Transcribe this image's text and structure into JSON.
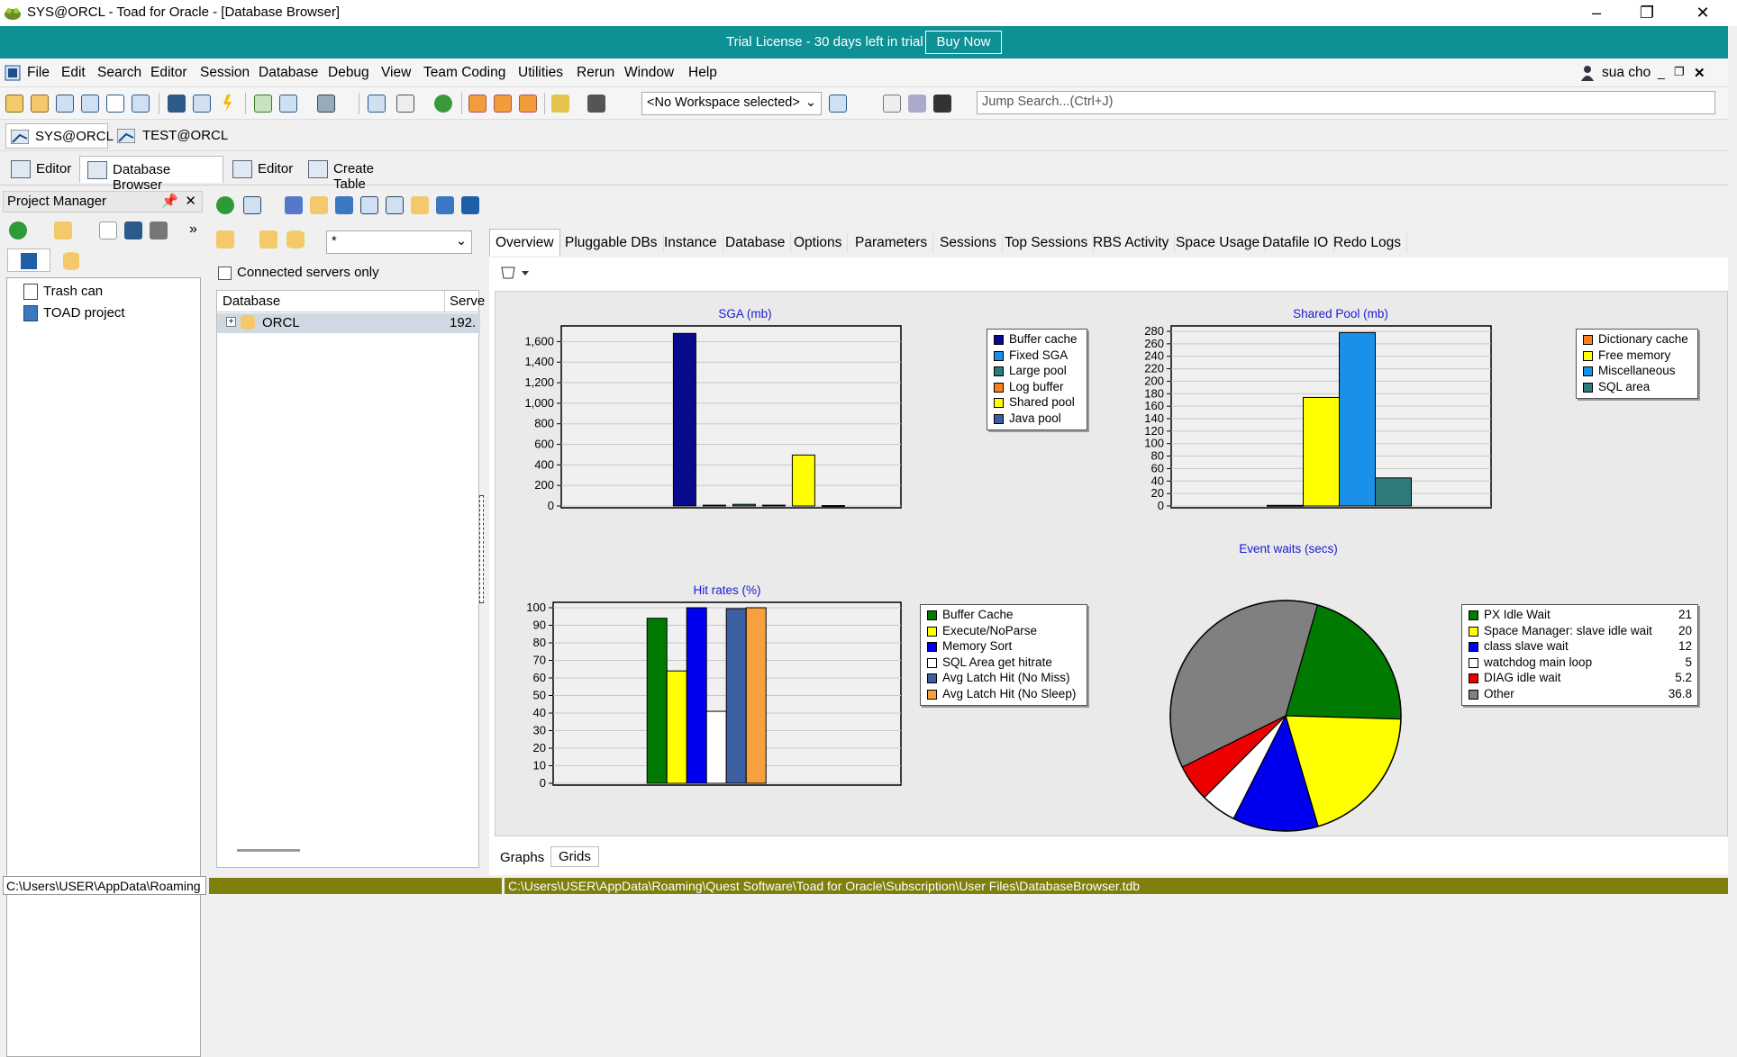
{
  "window": {
    "title": "SYS@ORCL - Toad for Oracle - [Database Browser]"
  },
  "trial": {
    "message": "Trial License - 30 days left in trial",
    "buy_label": "Buy Now"
  },
  "menu": {
    "items": [
      "File",
      "Edit",
      "Search",
      "Editor",
      "Session",
      "Database",
      "Debug",
      "View",
      "Team Coding",
      "Utilities",
      "Rerun",
      "Window",
      "Help"
    ],
    "user": "sua cho"
  },
  "toolbar": {
    "workspace": "<No Workspace selected>",
    "jump_placeholder": "Jump Search...(Ctrl+J)"
  },
  "connections": [
    "SYS@ORCL",
    "TEST@ORCL"
  ],
  "doc_tabs": [
    "Editor",
    "Database Browser",
    "Editor",
    "Create Table"
  ],
  "project_manager": {
    "title": "Project Manager",
    "tree": [
      "Trash can",
      "TOAD project"
    ]
  },
  "browser": {
    "filter_value": "*",
    "connected_only_label": "Connected servers only",
    "col_database": "Database",
    "col_server": "Serve",
    "row_db": "ORCL",
    "row_server": "192."
  },
  "subtabs": [
    "Overview",
    "Pluggable DBs",
    "Instance",
    "Database",
    "Options",
    "Parameters",
    "Sessions",
    "Top Sessions",
    "RBS Activity",
    "Space Usage",
    "Datafile IO",
    "Redo Logs"
  ],
  "bottom_tabs": [
    "Graphs",
    "Grids"
  ],
  "status": {
    "left": "C:\\Users\\USER\\AppData\\Roaming",
    "path": "C:\\Users\\USER\\AppData\\Roaming\\Quest Software\\Toad for Oracle\\Subscription\\User Files\\DatabaseBrowser.tdb"
  },
  "chart_data": [
    {
      "type": "bar",
      "title": "SGA (mb)",
      "ylim": [
        0,
        1700
      ],
      "yticks": [
        "0",
        "200",
        "400",
        "600",
        "800",
        "1,000",
        "1,200",
        "1,400",
        "1,600"
      ],
      "series": [
        {
          "name": "Buffer cache",
          "value": 1680,
          "color": "#0a0a8c"
        },
        {
          "name": "Fixed SGA",
          "value": 8,
          "color": "#1b90e8"
        },
        {
          "name": "Large pool",
          "value": 16,
          "color": "#2f7a7a"
        },
        {
          "name": "Log buffer",
          "value": 8,
          "color": "#ff7f1e"
        },
        {
          "name": "Shared pool",
          "value": 496,
          "color": "#ffff00"
        },
        {
          "name": "Java pool",
          "value": 4,
          "color": "#3b5fa0"
        }
      ]
    },
    {
      "type": "bar",
      "title": "Shared Pool (mb)",
      "ylim": [
        0,
        280
      ],
      "yticks": [
        "0",
        "20",
        "40",
        "60",
        "80",
        "100",
        "120",
        "140",
        "160",
        "180",
        "200",
        "220",
        "240",
        "260",
        "280"
      ],
      "series": [
        {
          "name": "Dictionary cache",
          "value": 1,
          "color": "#ff7f1e"
        },
        {
          "name": "Free memory",
          "value": 174,
          "color": "#ffff00"
        },
        {
          "name": "Miscellaneous",
          "value": 278,
          "color": "#1b90e8"
        },
        {
          "name": "SQL area",
          "value": 45,
          "color": "#2f7a7a"
        }
      ]
    },
    {
      "type": "bar",
      "title": "Hit rates (%)",
      "ylim": [
        0,
        100
      ],
      "yticks": [
        "0",
        "10",
        "20",
        "30",
        "40",
        "50",
        "60",
        "70",
        "80",
        "90",
        "100"
      ],
      "series": [
        {
          "name": "Buffer Cache",
          "value": 94,
          "color": "#007a00"
        },
        {
          "name": "Execute/NoParse",
          "value": 64,
          "color": "#ffff00"
        },
        {
          "name": "Memory Sort",
          "value": 100,
          "color": "#0000ee"
        },
        {
          "name": "SQL Area get hitrate",
          "value": 41,
          "color": "#ffffff"
        },
        {
          "name": "Avg Latch Hit (No Miss)",
          "value": 99.5,
          "color": "#3b5fa0"
        },
        {
          "name": "Avg Latch Hit (No Sleep)",
          "value": 100,
          "color": "#f7a040"
        }
      ]
    },
    {
      "type": "pie",
      "title": "Event waits (secs)",
      "slices": [
        {
          "name": "PX Idle Wait",
          "value": 21,
          "label": "21",
          "color": "#007a00"
        },
        {
          "name": "Space Manager: slave idle wait",
          "value": 20,
          "label": "20",
          "color": "#ffff00"
        },
        {
          "name": "class slave wait",
          "value": 12,
          "label": "12",
          "color": "#0000ee"
        },
        {
          "name": "watchdog main loop",
          "value": 5,
          "label": "5",
          "color": "#ffffff"
        },
        {
          "name": "DIAG idle wait",
          "value": 5.2,
          "label": "5.2",
          "color": "#ee0000"
        },
        {
          "name": "Other",
          "value": 36.8,
          "label": "36.8",
          "color": "#808080"
        }
      ]
    }
  ]
}
